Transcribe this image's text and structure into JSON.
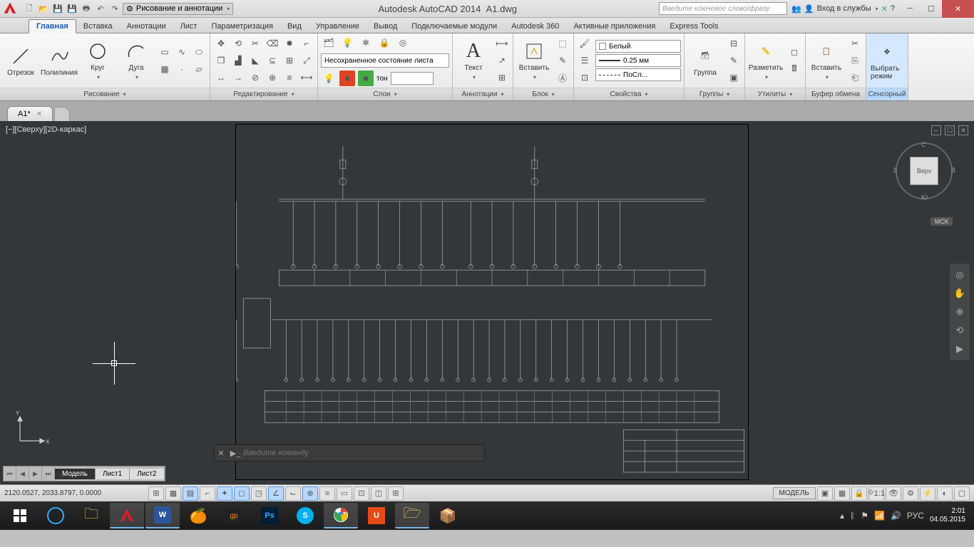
{
  "title": {
    "app": "Autodesk AutoCAD 2014",
    "file": "A1.dwg"
  },
  "workspace": "Рисование и аннотации",
  "search_placeholder": "Введите ключевое слово/фразу",
  "signin": "Вход в службы",
  "ribbon_tabs": [
    "Главная",
    "Вставка",
    "Аннотации",
    "Лист",
    "Параметризация",
    "Вид",
    "Управление",
    "Вывод",
    "Подключаемые модули",
    "Autodesk 360",
    "Активные приложения",
    "Express Tools"
  ],
  "panels": {
    "draw": {
      "title": "Рисование",
      "line": "Отрезок",
      "polyline": "Полилиния",
      "circle": "Круг",
      "arc": "Дуга"
    },
    "modify": {
      "title": "Редактирование"
    },
    "layers": {
      "title": "Слои",
      "state": "Несохраненное состояние листа",
      "tone": "тон"
    },
    "annot": {
      "title": "Аннотации",
      "text": "Текст"
    },
    "block": {
      "title": "Блок",
      "insert": "Вставить"
    },
    "props": {
      "title": "Свойства",
      "color": "Белый",
      "lw": "0.25 мм",
      "lt": "ПоСл..."
    },
    "groups": {
      "title": "Группы",
      "group": "Группа"
    },
    "utils": {
      "title": "Утилиты",
      "measure": "Разметить"
    },
    "clip": {
      "title": "Буфер обмена",
      "paste": "Вставить"
    },
    "touch": {
      "title": "Сенсорный",
      "select": "Выбрать режим"
    }
  },
  "file_tab": "A1*",
  "viewport_label": "[−][Сверху][2D-каркас]",
  "viewcube": {
    "top": "Верх",
    "n": "С",
    "s": "Ю",
    "e": "В",
    "w": "З"
  },
  "wcs": "МСК",
  "cmd_placeholder": "Введите команду",
  "layout_tabs": {
    "model": "Модель",
    "l1": "Лист1",
    "l2": "Лист2"
  },
  "coords": "2120.0527, 2033.8797, 0.0000",
  "model_space": "МОДЕЛЬ",
  "scale": "1:1",
  "lang": "РУС",
  "clock": {
    "time": "2:01",
    "date": "04.05.2015"
  }
}
